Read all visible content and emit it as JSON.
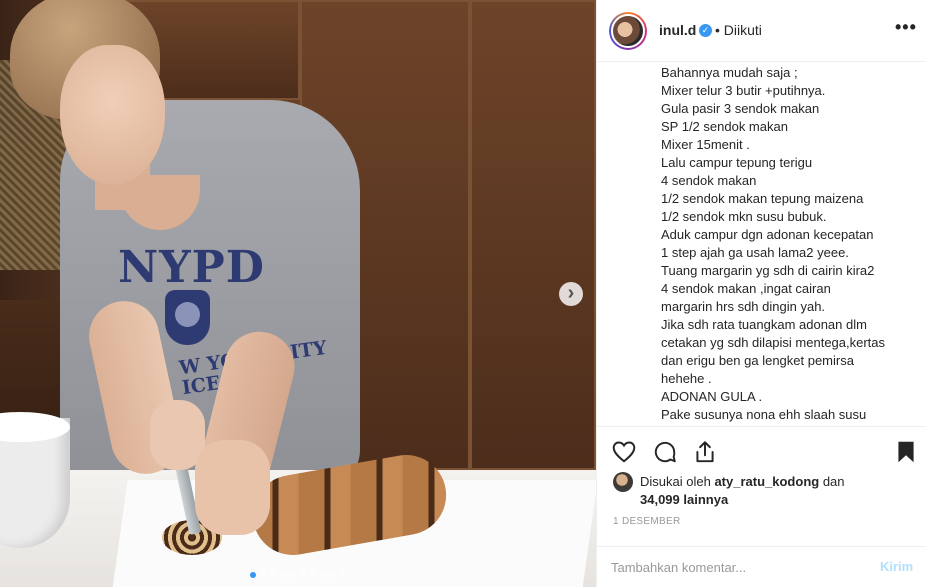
{
  "post": {
    "media": {
      "current_slide": 1,
      "total_slides": 10,
      "next_label": "›"
    },
    "header": {
      "username": "inul.d",
      "verified_mark": "✓",
      "follow_status": "• Diikuti",
      "more_label": "•••"
    },
    "caption_lines": [
      "Bahannya mudah saja ;",
      "Mixer telur 3 butir +putihnya.",
      "Gula pasir 3 sendok makan",
      "SP 1/2 sendok makan",
      "Mixer 15menit .",
      "Lalu campur tepung terigu",
      "4 sendok makan",
      "1/2 sendok makan tepung maizena",
      "1/2 sendok mkn susu bubuk.",
      "Aduk campur dgn adonan kecepatan",
      "1 step ajah ga usah lama2 yeee.",
      "Tuang margarin yg sdh di cairin kira2",
      "4 sendok makan ,ingat cairan",
      "margarin hrs sdh dingin yah.",
      "Jika sdh rata tuangkam adonan dlm",
      "cetakan yg sdh dilapisi mentega,kertas",
      "dan erigu ben ga lengket pemirsa",
      "hehehe .",
      "ADONAN GULA .",
      "Pake susunya nona ehh slaah susu"
    ],
    "likes": {
      "prefix": "Disukai oleh",
      "liker": "aty_ratu_kodong",
      "conj": "dan",
      "count": "34,099",
      "suffix": "lainnya"
    },
    "date": "1 DESEMBER",
    "comment": {
      "placeholder": "Tambahkan komentar...",
      "post_label": "Kirim"
    }
  },
  "colors": {
    "accent": "#3897f0",
    "post_disabled": "#b2dffc",
    "muted": "#999999",
    "text": "#262626"
  },
  "icons": [
    "heart-icon",
    "comment-icon",
    "share-icon",
    "bookmark-icon",
    "verified-icon",
    "more-icon",
    "chevron-right-icon"
  ]
}
